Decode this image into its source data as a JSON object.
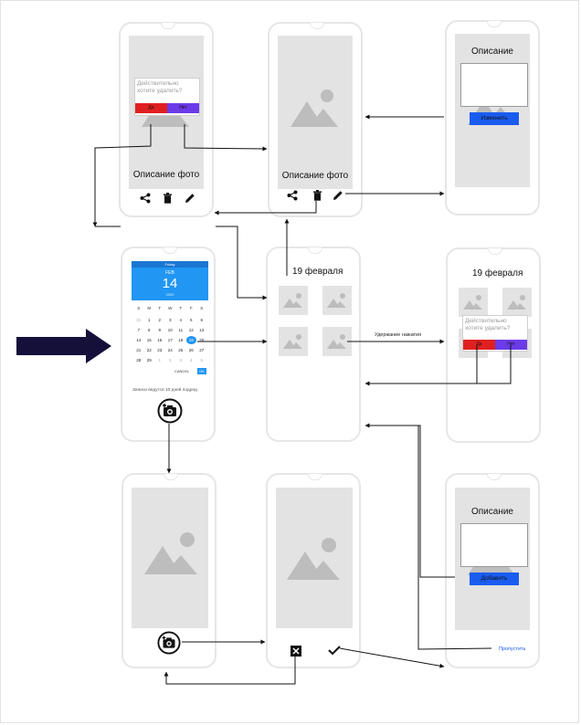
{
  "photo_view": {
    "caption": "Описание фото"
  },
  "delete_dialog": {
    "question": "Действительно хотите удалить?",
    "yes": "Да",
    "no": "Нет"
  },
  "edit_description": {
    "title": "Описание",
    "button": "Изменить"
  },
  "add_description": {
    "title": "Описание",
    "button": "Добавить",
    "skip": "Пропустить"
  },
  "gallery": {
    "date": "19 февраля"
  },
  "hold_label": "Удержание нажатия",
  "calendar": {
    "weekday": "Friday",
    "month": "FEB",
    "day": "14",
    "year": "2020",
    "weekdays": [
      "S",
      "M",
      "T",
      "W",
      "T",
      "F",
      "S"
    ],
    "rows": [
      [
        "31",
        "1",
        "2",
        "3",
        "4",
        "5",
        "6"
      ],
      [
        "7",
        "8",
        "9",
        "10",
        "11",
        "12",
        "13"
      ],
      [
        "14",
        "15",
        "16",
        "17",
        "18",
        "19",
        "20"
      ],
      [
        "21",
        "22",
        "23",
        "24",
        "25",
        "26",
        "27"
      ],
      [
        "28",
        "29",
        "1",
        "2",
        "3",
        "4",
        "5"
      ]
    ],
    "cancel": "CANCEL",
    "ok": "OK",
    "note": "Записи ведутся 10 дней подряд"
  },
  "colors": {
    "blue": "#2196f3",
    "red": "#e02020",
    "purple": "#6b3be8",
    "button_blue": "#1a5cf0",
    "arrow": "#14103a"
  },
  "icons": [
    "share-icon",
    "trash-icon",
    "pencil-icon",
    "camera-icon",
    "close-icon",
    "check-icon",
    "image-placeholder-icon",
    "arrow-right-icon"
  ]
}
